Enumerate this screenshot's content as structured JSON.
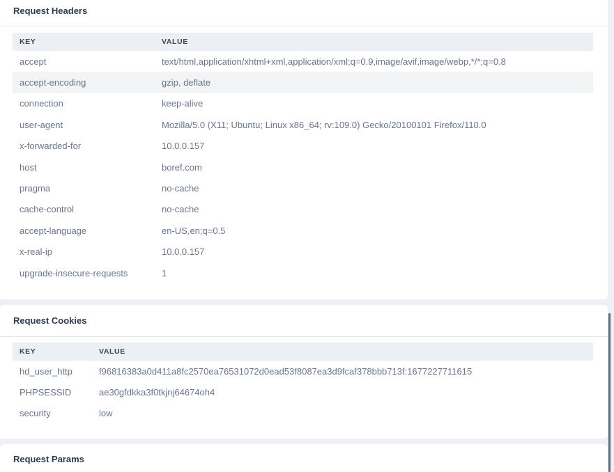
{
  "request_headers": {
    "title": "Request Headers",
    "columns": [
      "KEY",
      "VALUE"
    ],
    "rows": [
      {
        "key": "accept",
        "value": "text/html,application/xhtml+xml,application/xml;q=0.9,image/avif,image/webp,*/*;q=0.8"
      },
      {
        "key": "accept-encoding",
        "value": "gzip, deflate"
      },
      {
        "key": "connection",
        "value": "keep-alive"
      },
      {
        "key": "user-agent",
        "value": "Mozilla/5.0 (X11; Ubuntu; Linux x86_64; rv:109.0) Gecko/20100101 Firefox/110.0"
      },
      {
        "key": "x-forwarded-for",
        "value": "10.0.0.157"
      },
      {
        "key": "host",
        "value": "boref.com"
      },
      {
        "key": "pragma",
        "value": "no-cache"
      },
      {
        "key": "cache-control",
        "value": "no-cache"
      },
      {
        "key": "accept-language",
        "value": "en-US,en;q=0.5"
      },
      {
        "key": "x-real-ip",
        "value": "10.0.0.157"
      },
      {
        "key": "upgrade-insecure-requests",
        "value": "1"
      }
    ]
  },
  "request_cookies": {
    "title": "Request Cookies",
    "columns": [
      "KEY",
      "VALUE"
    ],
    "rows": [
      {
        "key": "hd_user_http",
        "value": "f96816383a0d411a8fc2570ea76531072d0ead53f8087ea3d9fcaf378bbb713f:1677227711615"
      },
      {
        "key": "PHPSESSID",
        "value": "ae30gfdkka3f0tkjnj64674oh4"
      },
      {
        "key": "security",
        "value": "low"
      }
    ]
  },
  "request_params": {
    "title": "Request Params"
  },
  "colors": {
    "panel_bg": "#ffffff",
    "page_bg": "#eef0f3",
    "header_row_bg": "#eceff3",
    "stripe_bg": "#f2f4f6",
    "text_muted": "#69768a",
    "text_title": "#2e3a4f"
  }
}
